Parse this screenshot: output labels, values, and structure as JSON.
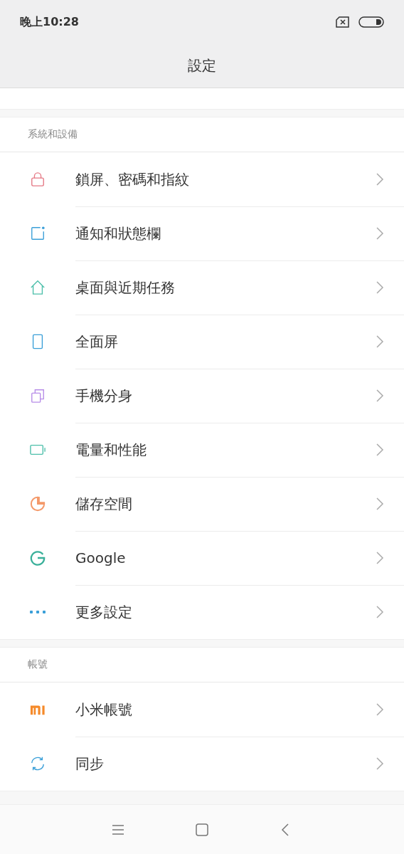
{
  "status_bar": {
    "time": "晚上10:28"
  },
  "header": {
    "title": "設定"
  },
  "sections": [
    {
      "title": "系統和設備",
      "items": [
        {
          "label": "鎖屏、密碼和指紋",
          "kind": "lock",
          "color": "#e57a86"
        },
        {
          "label": "通知和狀態欄",
          "kind": "notification",
          "color": "#3a9fd8"
        },
        {
          "label": "桌面與近期任務",
          "kind": "home",
          "color": "#4cbfaa"
        },
        {
          "label": "全面屏",
          "kind": "phone",
          "color": "#3a9fd8"
        },
        {
          "label": "手機分身",
          "kind": "copies",
          "color": "#b78de8"
        },
        {
          "label": "電量和性能",
          "kind": "battery",
          "color": "#4cbfaa"
        },
        {
          "label": "儲存空間",
          "kind": "pie",
          "color": "#f4996a"
        },
        {
          "label": "Google",
          "kind": "g",
          "color": "#3bb09a"
        },
        {
          "label": "更多設定",
          "kind": "dots",
          "color": "#3a9fd8"
        }
      ]
    },
    {
      "title": "帳號",
      "items": [
        {
          "label": "小米帳號",
          "kind": "mi",
          "color": "#f58a2a"
        },
        {
          "label": "同步",
          "kind": "sync",
          "color": "#3a9fd8"
        }
      ]
    }
  ]
}
